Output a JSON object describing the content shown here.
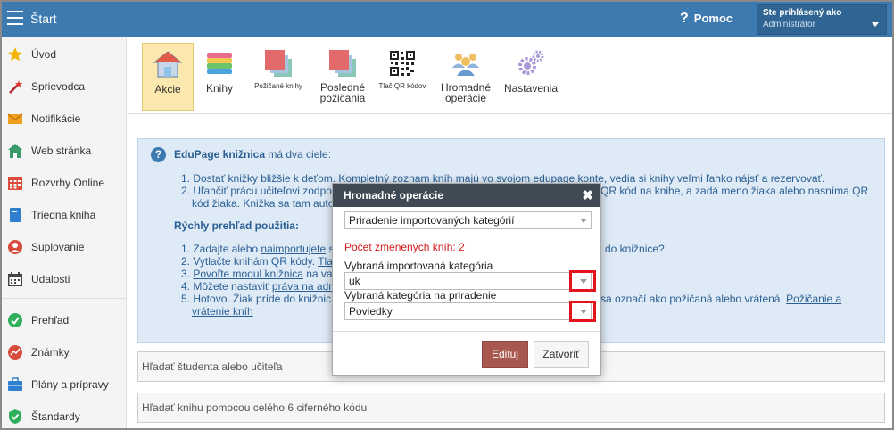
{
  "topbar": {
    "title": "Štart",
    "help": "Pomoc",
    "user_line1": "Ste prihlásený ako",
    "user_line2": "Administrátor"
  },
  "sidebar": {
    "items": [
      {
        "label": "Úvod",
        "icon": "star-icon"
      },
      {
        "label": "Sprievodca",
        "icon": "magic-wand-icon"
      },
      {
        "label": "Notifikácie",
        "icon": "envelope-icon"
      },
      {
        "label": "Web stránka",
        "icon": "house-icon"
      },
      {
        "label": "Rozvrhy Online",
        "icon": "timetable-icon"
      },
      {
        "label": "Triedna kniha",
        "icon": "book-icon"
      },
      {
        "label": "Suplovanie",
        "icon": "person-icon"
      },
      {
        "label": "Udalosti",
        "icon": "calendar-icon"
      },
      {
        "label": "Prehľad",
        "icon": "check-circle-icon"
      },
      {
        "label": "Známky",
        "icon": "grades-icon"
      },
      {
        "label": "Plány a prípravy",
        "icon": "briefcase-icon"
      },
      {
        "label": "Štandardy",
        "icon": "shield-check-icon"
      }
    ]
  },
  "toolbar": {
    "items": [
      {
        "label": "Akcie",
        "icon": "home-icon",
        "active": true
      },
      {
        "label": "Knihy",
        "icon": "books-stack-icon"
      },
      {
        "label": "Požičané knihy",
        "icon": "borrowed-books-icon"
      },
      {
        "label_line1": "Posledné",
        "label_line2": "požičania",
        "icon": "recent-loans-icon"
      },
      {
        "label": "Tlač QR kódov",
        "icon": "qr-code-icon"
      },
      {
        "label_line1": "Hromadné",
        "label_line2": "operácie",
        "icon": "group-users-icon"
      },
      {
        "label": "Nastavenia",
        "icon": "gears-icon"
      }
    ]
  },
  "info": {
    "title_bold": "EduPage knižnica",
    "title_rest": " má dva ciele:",
    "goal1": "1. Dostať knižky bližšie k deťom. Kompletný zoznam kníh majú vo svojom edupage konte, vedia si knihy veľmi ľahko nájsť a rezervovať.",
    "goal2a": "2. Uľahčiť prácu učiteľovi zodpo",
    "goal2a_right": "QR kód na knihe, a zadá meno žiaka alebo nasníma QR",
    "goal2b": "kód žiaka. Knižka sa tam auto",
    "overview_title": "Rýchly prehľad použitia:",
    "step1_pre": "1. Zadajte alebo ",
    "step1_link": "naimportujete",
    "step1_post": " s",
    "step1_right": "do knižnice?",
    "step2_pre": "2. Vytlačte knihám QR kódy. ",
    "step2_link": "Tla",
    "step3_pre": "3. ",
    "step3_link": "Povoľte modul knižnica",
    "step3_post": " na val",
    "step4_pre": "4. Môžete nastaviť ",
    "step4_link": "práva na adm",
    "step5_pre": "5. Hotovo. Žiak príde do knižnic",
    "step5_right": "sa označí ako požičaná alebo vrátená. ",
    "step5_link": "Požičanie a",
    "step5_link2": "vrátenie kníh"
  },
  "search": {
    "student": "Hľadať študenta alebo učiteľa",
    "book": "Hľadať knihu pomocou celého 6 ciferného kódu"
  },
  "modal": {
    "title": "Hromadné operácie",
    "operation_value": "Priradenie importovaných kategórií",
    "changed_count": "Počet zmenených kníh: 2",
    "imported_label": "Vybraná importovaná kategória",
    "imported_value": "uk",
    "assign_label": "Vybraná kategória na priradenie",
    "assign_value": "Poviedky",
    "edit_button": "Edituj",
    "close_button": "Zatvoriť"
  },
  "colors": {
    "topbar": "#3d7ab0",
    "highlight": "#e2141c",
    "edit_button": "#a8584e",
    "active_tool": "#fbe8ae"
  }
}
